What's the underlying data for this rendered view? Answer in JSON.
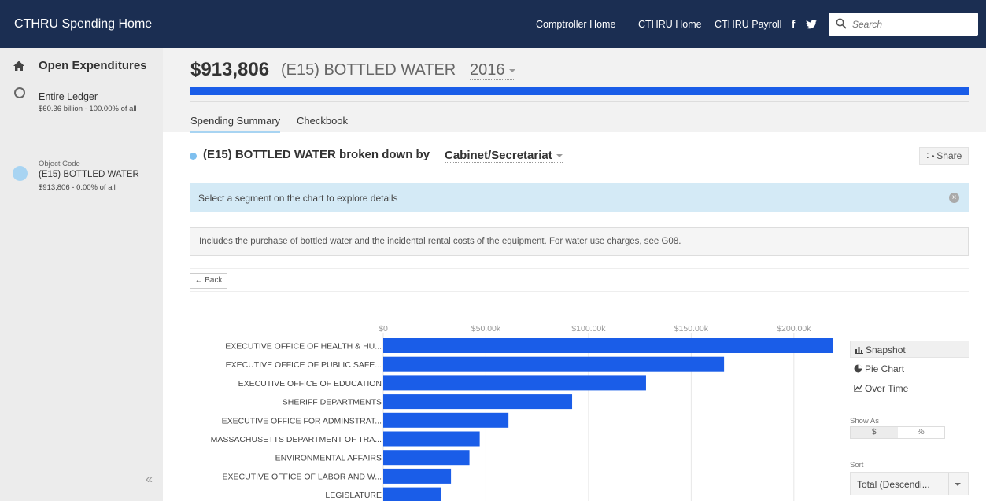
{
  "header": {
    "brand": "CTHRU Spending Home",
    "links": [
      "Comptroller Home",
      "CTHRU Home",
      "CTHRU Payroll"
    ],
    "social": {
      "facebook": "f",
      "twitter_icon": "twitter-icon"
    },
    "search_placeholder": "Search"
  },
  "sidebar": {
    "title": "Open Expenditures",
    "steps": [
      {
        "title": "Entire Ledger",
        "subtitle": "$60.36 billion - 100.00% of all"
      },
      {
        "label": "Object Code",
        "title": "(E15) BOTTLED WATER",
        "subtitle": "$913,806  - 0.00% of all"
      }
    ],
    "collapse_glyph": "«"
  },
  "summary": {
    "amount": "$913,806",
    "name": "(E15) BOTTLED WATER",
    "year": "2016",
    "progress_fraction": 1.0,
    "tabs": [
      "Spending Summary",
      "Checkbook"
    ]
  },
  "breakdown": {
    "title": "(E15) BOTTLED WATER broken down by",
    "dimension": "Cabinet/Secretariat",
    "share_label": "Share",
    "info_message": "Select a segment on the chart to explore details",
    "description": "Includes the purchase of bottled water and the incidental rental costs of the equipment. For water use charges, see G08.",
    "back_label": "← Back"
  },
  "chart_data": {
    "type": "bar",
    "orientation": "horizontal",
    "x_ticks": [
      "$0",
      "$50.00k",
      "$100.00k",
      "$150.00k",
      "$200.00k"
    ],
    "xlim": [
      0,
      220000
    ],
    "grid": true,
    "bar_color": "#1a5de8",
    "categories": [
      "EXECUTIVE OFFICE OF HEALTH & HU...",
      "EXECUTIVE OFFICE OF PUBLIC SAFE...",
      "EXECUTIVE OFFICE OF EDUCATION",
      "SHERIFF DEPARTMENTS",
      "EXECUTIVE OFFICE FOR ADMINSTRAT...",
      "MASSACHUSETTS DEPARTMENT OF TRA...",
      "ENVIRONMENTAL AFFAIRS",
      "EXECUTIVE OFFICE OF LABOR AND W...",
      "LEGISLATURE"
    ],
    "values": [
      219000,
      166000,
      128000,
      92000,
      61000,
      47000,
      42000,
      33000,
      28000
    ]
  },
  "panel": {
    "views": [
      "Snapshot",
      "Pie Chart",
      "Over Time"
    ],
    "show_as_label": "Show As",
    "show_as_options": [
      "$",
      "%"
    ],
    "sort_label": "Sort",
    "sort_value": "Total (Descendi..."
  }
}
